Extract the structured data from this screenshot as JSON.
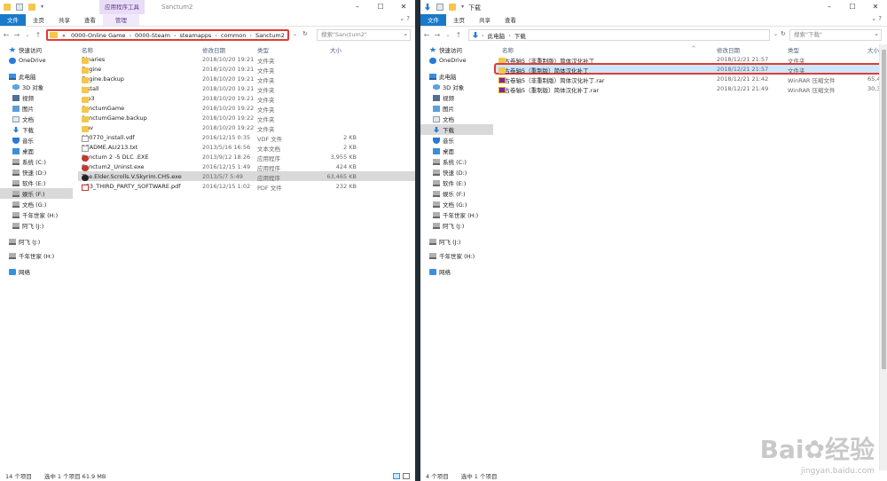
{
  "left": {
    "title": "Sanctum2",
    "context_tab": "应用程序工具",
    "ribbon_tabs": [
      "文件",
      "主页",
      "共享",
      "查看",
      "管理"
    ],
    "address": [
      "0000-Online Game",
      "0000-Steam",
      "steamapps",
      "common",
      "Sanctum2"
    ],
    "address_prefix": "«",
    "search_placeholder": "搜索\"Sanctum2\"",
    "columns": {
      "name": "名称",
      "date": "修改日期",
      "type": "类型",
      "size": "大小"
    },
    "files": [
      {
        "name": "Binaries",
        "date": "2018/10/20 19:21",
        "type": "文件夹",
        "size": "",
        "icon": "folder-icon"
      },
      {
        "name": "Engine",
        "date": "2018/10/20 19:21",
        "type": "文件夹",
        "size": "",
        "icon": "folder-icon"
      },
      {
        "name": "Engine.backup",
        "date": "2018/10/20 19:21",
        "type": "文件夹",
        "size": "",
        "icon": "folder-icon"
      },
      {
        "name": "Install",
        "date": "2018/10/20 19:21",
        "type": "文件夹",
        "size": "",
        "icon": "folder-icon"
      },
      {
        "name": "mp3",
        "date": "2018/10/20 19:21",
        "type": "文件夹",
        "size": "",
        "icon": "folder-icon"
      },
      {
        "name": "SanctumGame",
        "date": "2018/10/20 19:22",
        "type": "文件夹",
        "size": "",
        "icon": "folder-icon"
      },
      {
        "name": "SanctumGame.backup",
        "date": "2018/10/20 19:22",
        "type": "文件夹",
        "size": "",
        "icon": "folder-icon"
      },
      {
        "name": "wav",
        "date": "2018/10/20 19:22",
        "type": "文件夹",
        "size": "",
        "icon": "folder-icon"
      },
      {
        "name": "210770_install.vdf",
        "date": "2016/12/15 0:35",
        "type": "VDF 文件",
        "size": "2 KB",
        "icon": "file-icon"
      },
      {
        "name": "README.ALI213.txt",
        "date": "2013/5/16 16:56",
        "type": "文本文档",
        "size": "2 KB",
        "icon": "file-icon"
      },
      {
        "name": "Sanctum 2 -5 DLC .EXE",
        "date": "2013/9/12 18:26",
        "type": "应用程序",
        "size": "3,955 KB",
        "icon": "exe-icon"
      },
      {
        "name": "Sanctum2_Uninst.exe",
        "date": "2016/12/15 1:49",
        "type": "应用程序",
        "size": "424 KB",
        "icon": "exe-icon"
      },
      {
        "name": "The.Elder.Scrolls.V.Skyrim.CHS.exe",
        "date": "2013/5/7 5:49",
        "type": "应用程序",
        "size": "63,465 KB",
        "icon": "skyrim-icon"
      },
      {
        "name": "UE3_THIRD_PARTY_SOFTWARE.pdf",
        "date": "2016/12/15 1:02",
        "type": "PDF 文件",
        "size": "232 KB",
        "icon": "pdf-icon"
      }
    ],
    "selected_row": 12,
    "status_count": "14 个项目",
    "status_selected": "选中 1 个项目  61.9 MB"
  },
  "right": {
    "title": "下载",
    "ribbon_tabs": [
      "文件",
      "主页",
      "共享",
      "查看"
    ],
    "address": [
      "此电脑",
      "下载"
    ],
    "search_placeholder": "搜索\"下载\"",
    "columns": {
      "name": "名称",
      "date": "修改日期",
      "type": "类型",
      "size": "大小"
    },
    "files": [
      {
        "name": "上古卷轴5（非重制版）简体汉化补丁",
        "date": "2018/12/21 21:57",
        "type": "文件夹",
        "size": "",
        "icon": "folder-icon"
      },
      {
        "name": "上古卷轴5（重制版）简体汉化补丁",
        "date": "2018/12/21 21:57",
        "type": "文件夹",
        "size": "",
        "icon": "folder-icon"
      },
      {
        "name": "上古卷轴5（非重制版）简体汉化补丁.rar",
        "date": "2018/12/21 21:42",
        "type": "WinRAR 压缩文件",
        "size": "65,47",
        "icon": "rar-icon"
      },
      {
        "name": "上古卷轴5（重制版）简体汉化补丁.rar",
        "date": "2018/12/21 21:49",
        "type": "WinRAR 压缩文件",
        "size": "30,37",
        "icon": "rar-icon"
      }
    ],
    "selected_row": 1,
    "status_count": "4 个项目",
    "status_selected": "选中 1 个项目"
  },
  "nav": [
    {
      "label": "快速访问",
      "icon": "star-icon",
      "indent": 0
    },
    {
      "label": "OneDrive",
      "icon": "cloud-icon",
      "indent": 0
    },
    {
      "label": "此电脑",
      "icon": "pc-icon",
      "indent": 0
    },
    {
      "label": "3D 对象",
      "icon": "cube-icon",
      "indent": 1
    },
    {
      "label": "视频",
      "icon": "video-icon",
      "indent": 1
    },
    {
      "label": "图片",
      "icon": "picture-icon",
      "indent": 1
    },
    {
      "label": "文档",
      "icon": "document-icon",
      "indent": 1
    },
    {
      "label": "下载",
      "icon": "download-icon",
      "indent": 1
    },
    {
      "label": "音乐",
      "icon": "music-icon",
      "indent": 1
    },
    {
      "label": "桌面",
      "icon": "desktop-icon",
      "indent": 1
    },
    {
      "label": "系统 (C:)",
      "icon": "drive-icon",
      "indent": 1
    },
    {
      "label": "快速 (D:)",
      "icon": "drive-icon",
      "indent": 1
    },
    {
      "label": "软件 (E:)",
      "icon": "drive-icon",
      "indent": 1
    },
    {
      "label": "娱乐 (F:)",
      "icon": "drive-icon",
      "indent": 1
    },
    {
      "label": "文档 (G:)",
      "icon": "drive-icon",
      "indent": 1
    },
    {
      "label": "千年世家 (H:)",
      "icon": "drive-icon",
      "indent": 1
    },
    {
      "label": "阿飞 (J:)",
      "icon": "drive-icon",
      "indent": 1
    },
    {
      "label": "阿飞 (J:)",
      "icon": "drive-icon",
      "indent": 0
    },
    {
      "label": "千年世家 (H:)",
      "icon": "drive-icon",
      "indent": 0
    },
    {
      "label": "网络",
      "icon": "network-icon",
      "indent": 0
    }
  ],
  "left_nav_selected": 13,
  "right_nav_selected": 7,
  "watermark": {
    "brand": "Bai",
    "brand2": "经验",
    "url": "jingyan.baidu.com"
  },
  "colors": {
    "accent": "#1979ca",
    "highlight": "#e53935",
    "selection": "#cce8ff",
    "context_tab": "#e9dcf6"
  }
}
